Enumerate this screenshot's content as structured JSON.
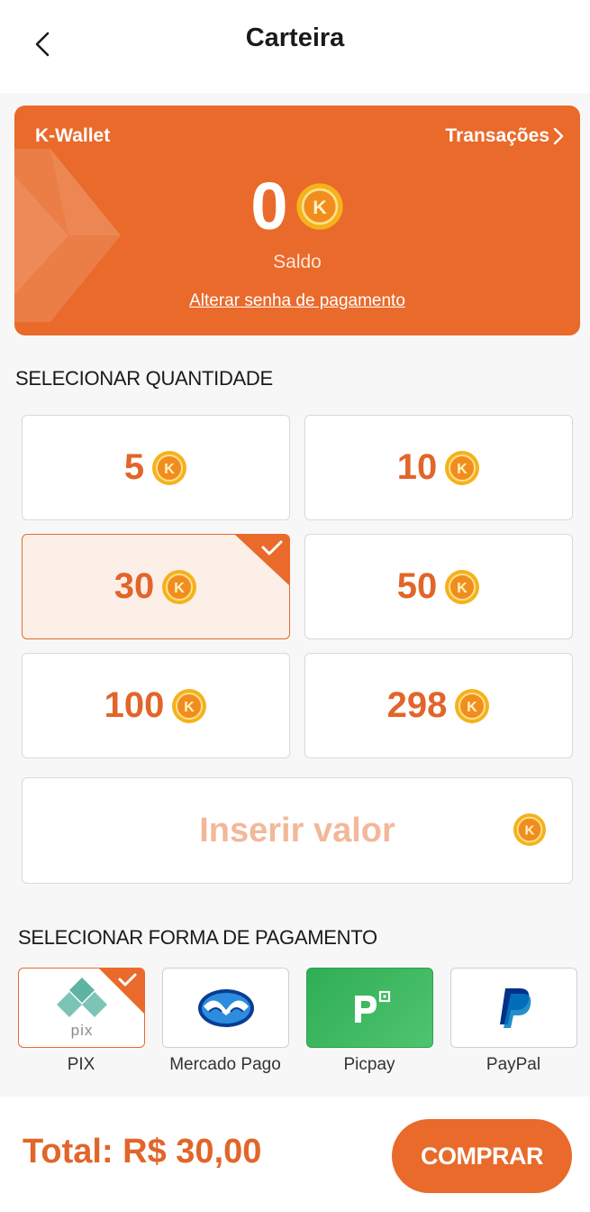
{
  "header": {
    "title": "Carteira"
  },
  "wallet": {
    "name": "K-Wallet",
    "transactions_label": "Transações",
    "balance": "0",
    "balance_label": "Saldo",
    "change_password_label": "Alterar senha de pagamento"
  },
  "coin": {
    "letter": "K"
  },
  "quantity": {
    "title": "SELECIONAR QUANTIDADE",
    "options": [
      "5",
      "10",
      "30",
      "50",
      "100",
      "298"
    ],
    "selected": "30",
    "custom_placeholder": "Inserir valor"
  },
  "payment": {
    "title": "SELECIONAR FORMA DE PAGAMENTO",
    "methods": [
      {
        "label": "PIX",
        "icon": "pix-icon"
      },
      {
        "label": "Mercado Pago",
        "icon": "mercado-pago-icon"
      },
      {
        "label": "Picpay",
        "icon": "picpay-icon"
      },
      {
        "label": "PayPal",
        "icon": "paypal-icon"
      }
    ],
    "selected": "PIX",
    "pix_logo_text": "pix"
  },
  "footer": {
    "total": "Total: R$ 30,00",
    "buy_label": "COMPRAR"
  },
  "colors": {
    "accent": "#e96a2b",
    "selected_bg": "#fbefe8",
    "coin": "#f5b21c"
  }
}
